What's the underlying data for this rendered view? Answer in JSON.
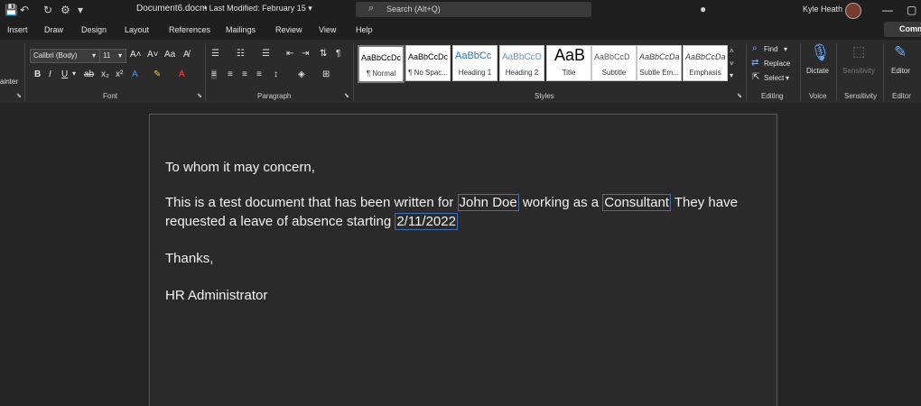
{
  "titlebar": {
    "doc_name": "Document6.docm",
    "modified": "• Last Modified: February 15  ▾",
    "search_placeholder": "Search (Alt+Q)",
    "user_name": "Kyle Heath"
  },
  "menu": [
    "Insert",
    "Draw",
    "Design",
    "Layout",
    "References",
    "Mailings",
    "Review",
    "View",
    "Help"
  ],
  "comments_label": "Comm",
  "ribbon": {
    "font_name": "Calibri (Body)",
    "font_size": "11",
    "format_painter_label": "ainter",
    "groups": {
      "font": "Font",
      "paragraph": "Paragraph",
      "styles": "Styles",
      "editing": "Editing",
      "voice": "Voice",
      "sensitivity": "Sensitivity",
      "editor": "Editor"
    },
    "styles": [
      {
        "sample": "AaBbCcDc",
        "name": "¶ Normal",
        "color": "#000000"
      },
      {
        "sample": "AaBbCcDc",
        "name": "¶ No Spac...",
        "color": "#000000"
      },
      {
        "sample": "AaBbCc",
        "name": "Heading 1",
        "color": "#2f75b5"
      },
      {
        "sample": "AaBbCcD",
        "name": "Heading 2",
        "color": "#5b9bd5"
      },
      {
        "sample": "AaB",
        "name": "Title",
        "color": "#000000"
      },
      {
        "sample": "AaBbCcD",
        "name": "Subtitle",
        "color": "#595959"
      },
      {
        "sample": "AaBbCcDa",
        "name": "Subtle Em...",
        "color": "#404040"
      },
      {
        "sample": "AaBbCcDa",
        "name": "Emphasis",
        "color": "#404040"
      }
    ],
    "find_label": "Find",
    "replace_label": "Replace",
    "select_label": "Select",
    "dictate_label": "Dictate",
    "sensitivity_label": "Sensitivity",
    "editor_label": "Editor"
  },
  "document": {
    "greeting": "To whom it may concern,",
    "body_prefix": "This is a test document that has been written for ",
    "name_field": "John Doe",
    "body_mid": " working  as a ",
    "role_field": "Consultant",
    "body_suffix": "  They have",
    "line2_prefix": "requested a leave of absence starting ",
    "date_field": "2/11/2022",
    "thanks": "Thanks,",
    "signature": "HR Administrator"
  }
}
